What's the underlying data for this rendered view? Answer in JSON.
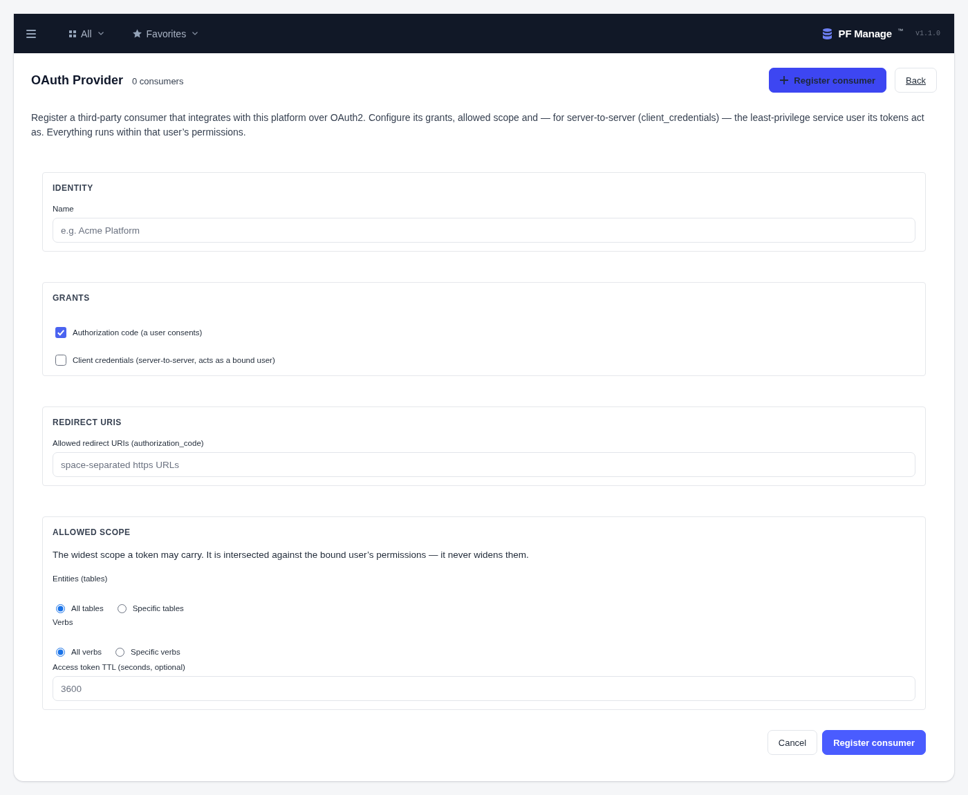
{
  "nav": {
    "menus": [
      {
        "label": "All"
      },
      {
        "label": "Favorites"
      }
    ],
    "brand": {
      "name": "PF Manage",
      "mark": "™",
      "version": "v1.1.0"
    }
  },
  "header": {
    "title": "OAuth Provider",
    "count": "0 consumers",
    "buttons": [
      {
        "label": "Register consumer",
        "kind": "primary"
      },
      {
        "label": "Back",
        "kind": "link"
      }
    ]
  },
  "description": "Register a third-party consumer that integrates with this platform over OAuth2. Configure its grants, allowed scope and — for server-to-server (client_credentials) — the least-privilege service user its tokens act as. Everything runs within that user’s permissions.",
  "sections": [
    {
      "title": "IDENTITY",
      "fields": [
        {
          "kind": "input",
          "label": "Name",
          "placeholder": "e.g. Acme Platform"
        }
      ]
    },
    {
      "title": "GRANTS",
      "fields": [
        {
          "kind": "checkbox",
          "label": "Authorization code (a user consents)",
          "checked": true
        },
        {
          "kind": "checkbox",
          "label": "Client credentials (server-to-server, acts as a bound user)",
          "checked": false
        }
      ]
    },
    {
      "title": "REDIRECT URIS",
      "fields": [
        {
          "kind": "input",
          "label": "Allowed redirect URIs (authorization_code)",
          "placeholder": "space-separated https URLs"
        }
      ]
    },
    {
      "title": "ALLOWED SCOPE",
      "fields": [
        {
          "kind": "note",
          "text": "The widest scope a token may carry. It is intersected against the bound user’s permissions — it never widens them."
        },
        {
          "kind": "radio_group",
          "label": "Entities (tables)",
          "options": [
            {
              "label": "All tables",
              "selected": true
            },
            {
              "label": "Specific tables",
              "selected": false
            }
          ]
        },
        {
          "kind": "radio_group",
          "label": "Verbs",
          "options": [
            {
              "label": "All verbs",
              "selected": true
            },
            {
              "label": "Specific verbs",
              "selected": false
            }
          ]
        },
        {
          "kind": "input",
          "label": "Access token TTL (seconds, optional)",
          "placeholder": "3600"
        }
      ]
    }
  ],
  "footer_buttons": [
    {
      "label": "Cancel",
      "kind": "secondary"
    },
    {
      "label": "Register consumer",
      "kind": "primary"
    }
  ]
}
